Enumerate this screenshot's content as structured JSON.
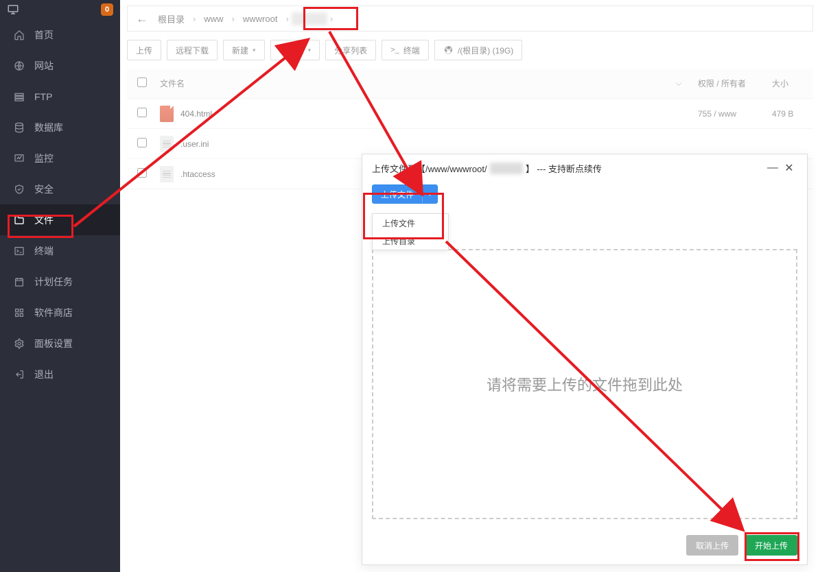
{
  "sidebar": {
    "badge": "0",
    "items": [
      {
        "key": "home",
        "label": "首页"
      },
      {
        "key": "site",
        "label": "网站"
      },
      {
        "key": "ftp",
        "label": "FTP"
      },
      {
        "key": "db",
        "label": "数据库"
      },
      {
        "key": "monitor",
        "label": "监控"
      },
      {
        "key": "safe",
        "label": "安全"
      },
      {
        "key": "files",
        "label": "文件",
        "active": true
      },
      {
        "key": "term",
        "label": "终端"
      },
      {
        "key": "cron",
        "label": "计划任务"
      },
      {
        "key": "store",
        "label": "软件商店"
      },
      {
        "key": "settings",
        "label": "面板设置"
      },
      {
        "key": "logout",
        "label": "退出"
      }
    ]
  },
  "breadcrumb": {
    "root": "根目录",
    "p1": "www",
    "p2": "wwwroot",
    "p3_hidden": "site"
  },
  "toolbar": {
    "upload": "上传",
    "remote": "远程下载",
    "new": "新建",
    "fav": "收藏夹",
    "share": "分享列表",
    "terminal": "终端",
    "root": "/(根目录) (19G)"
  },
  "table": {
    "head": {
      "name": "文件名",
      "perm": "权限 / 所有者",
      "size": "大小"
    },
    "rows": [
      {
        "name": "404.html",
        "type": "html",
        "perm": "755 / www",
        "size": "479 B"
      },
      {
        "name": ".user.ini",
        "type": "txt",
        "perm": "",
        "size": ""
      },
      {
        "name": ".htaccess",
        "type": "txt",
        "perm": "",
        "size": ""
      }
    ]
  },
  "modal": {
    "title_prefix": "上传文件到【/www/wwwroot/",
    "title_suffix": "】 --- 支持断点续传",
    "upload_btn": "上传文件",
    "dd1": "上传文件",
    "dd2": "上传目录",
    "dropzone": "请将需要上传的文件拖到此处",
    "cancel": "取消上传",
    "start": "开始上传"
  }
}
